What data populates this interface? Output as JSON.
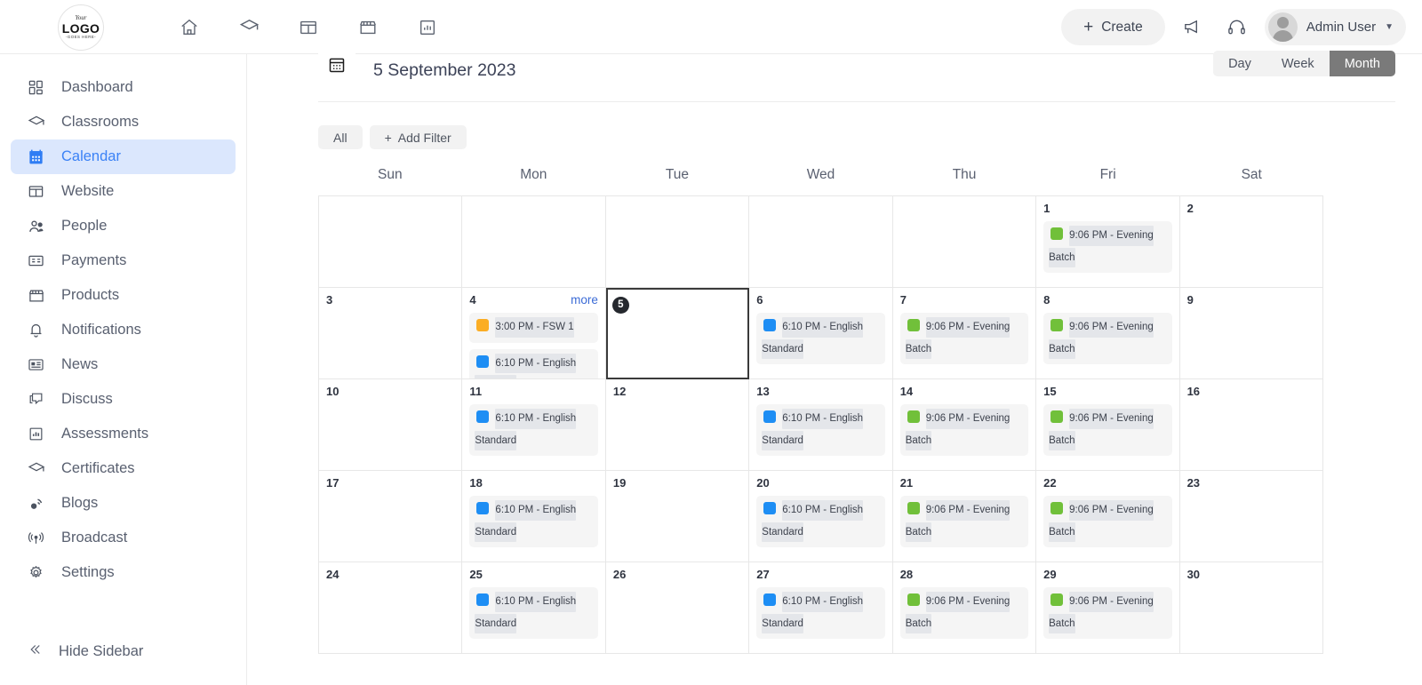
{
  "header": {
    "logo": {
      "line1": "Your",
      "line2": "LOGO",
      "line3": "-GOES HERE-"
    },
    "nav_icons": [
      "home-icon",
      "graduation-cap-icon",
      "website-layout-icon",
      "store-icon",
      "analytics-icon"
    ],
    "create_label": "Create",
    "create_plus": "+",
    "announce_icon": "megaphone-icon",
    "support_icon": "headset-icon",
    "user_name": "Admin User",
    "chevron": "⌄"
  },
  "sidebar": {
    "items": [
      {
        "label": "Dashboard",
        "icon": "dashboard-icon",
        "active": false
      },
      {
        "label": "Classrooms",
        "icon": "graduation-cap-icon",
        "active": false
      },
      {
        "label": "Calendar",
        "icon": "calendar-icon",
        "active": true
      },
      {
        "label": "Website",
        "icon": "website-layout-icon",
        "active": false
      },
      {
        "label": "People",
        "icon": "people-icon",
        "active": false
      },
      {
        "label": "Payments",
        "icon": "payments-card-icon",
        "active": false
      },
      {
        "label": "Products",
        "icon": "store-icon",
        "active": false
      },
      {
        "label": "Notifications",
        "icon": "bell-icon",
        "active": false
      },
      {
        "label": "News",
        "icon": "news-icon",
        "active": false
      },
      {
        "label": "Discuss",
        "icon": "chat-bubble-icon",
        "active": false
      },
      {
        "label": "Assessments",
        "icon": "bar-chart-icon",
        "active": false
      },
      {
        "label": "Certificates",
        "icon": "graduation-cap-icon",
        "active": false
      },
      {
        "label": "Blogs",
        "icon": "blog-rss-icon",
        "active": false
      },
      {
        "label": "Broadcast",
        "icon": "broadcast-antenna-icon",
        "active": false
      },
      {
        "label": "Settings",
        "icon": "gear-icon",
        "active": false
      }
    ],
    "hide_label": "Hide Sidebar",
    "hide_icon": "double-chevron-left-icon",
    "active_bg": "#dbe7fd",
    "active_fg": "#3b82f6"
  },
  "calendar": {
    "date_title": "5 September 2023",
    "date_icon": "calendar-grid-icon",
    "views": [
      {
        "label": "Day",
        "active": false
      },
      {
        "label": "Week",
        "active": false
      },
      {
        "label": "Month",
        "active": true
      }
    ],
    "filters": [
      {
        "label": "All",
        "prefix": ""
      },
      {
        "label": "Add Filter",
        "prefix": "+"
      }
    ],
    "more_label": "more",
    "weekdays": [
      "Sun",
      "Mon",
      "Tue",
      "Wed",
      "Thu",
      "Fri",
      "Sat"
    ],
    "event_colors": {
      "blue": "#1e8ef4",
      "green": "#71c03a",
      "orange": "#fbad24"
    },
    "weeks": [
      [
        {
          "day": "",
          "events": []
        },
        {
          "day": "",
          "events": []
        },
        {
          "day": "",
          "events": []
        },
        {
          "day": "",
          "events": []
        },
        {
          "day": "",
          "events": []
        },
        {
          "day": "1",
          "events": [
            {
              "time": "9:06 PM - Evening",
              "title": "Batch",
              "color": "green"
            }
          ]
        },
        {
          "day": "2",
          "events": []
        }
      ],
      [
        {
          "day": "3",
          "events": []
        },
        {
          "day": "4",
          "more": true,
          "events": [
            {
              "time": "3:00 PM - FSW 1",
              "title": "",
              "color": "orange"
            },
            {
              "time": "6:10 PM - English",
              "title": "Standard",
              "color": "blue"
            }
          ]
        },
        {
          "day": "5",
          "today": true,
          "events": []
        },
        {
          "day": "6",
          "events": [
            {
              "time": "6:10 PM - English",
              "title": "Standard",
              "color": "blue"
            }
          ]
        },
        {
          "day": "7",
          "events": [
            {
              "time": "9:06 PM - Evening",
              "title": "Batch",
              "color": "green"
            }
          ]
        },
        {
          "day": "8",
          "events": [
            {
              "time": "9:06 PM - Evening",
              "title": "Batch",
              "color": "green"
            }
          ]
        },
        {
          "day": "9",
          "events": []
        }
      ],
      [
        {
          "day": "10",
          "events": []
        },
        {
          "day": "11",
          "events": [
            {
              "time": "6:10 PM - English",
              "title": "Standard",
              "color": "blue"
            }
          ]
        },
        {
          "day": "12",
          "events": []
        },
        {
          "day": "13",
          "events": [
            {
              "time": "6:10 PM - English",
              "title": "Standard",
              "color": "blue"
            }
          ]
        },
        {
          "day": "14",
          "events": [
            {
              "time": "9:06 PM - Evening",
              "title": "Batch",
              "color": "green"
            }
          ]
        },
        {
          "day": "15",
          "events": [
            {
              "time": "9:06 PM - Evening",
              "title": "Batch",
              "color": "green"
            }
          ]
        },
        {
          "day": "16",
          "events": []
        }
      ],
      [
        {
          "day": "17",
          "events": []
        },
        {
          "day": "18",
          "events": [
            {
              "time": "6:10 PM - English",
              "title": "Standard",
              "color": "blue"
            }
          ]
        },
        {
          "day": "19",
          "events": []
        },
        {
          "day": "20",
          "events": [
            {
              "time": "6:10 PM - English",
              "title": "Standard",
              "color": "blue"
            }
          ]
        },
        {
          "day": "21",
          "events": [
            {
              "time": "9:06 PM - Evening",
              "title": "Batch",
              "color": "green"
            }
          ]
        },
        {
          "day": "22",
          "events": [
            {
              "time": "9:06 PM - Evening",
              "title": "Batch",
              "color": "green"
            }
          ]
        },
        {
          "day": "23",
          "events": []
        }
      ],
      [
        {
          "day": "24",
          "events": []
        },
        {
          "day": "25",
          "events": [
            {
              "time": "6:10 PM - English",
              "title": "Standard",
              "color": "blue"
            }
          ]
        },
        {
          "day": "26",
          "events": []
        },
        {
          "day": "27",
          "events": [
            {
              "time": "6:10 PM - English",
              "title": "Standard",
              "color": "blue"
            }
          ]
        },
        {
          "day": "28",
          "events": [
            {
              "time": "9:06 PM - Evening",
              "title": "Batch",
              "color": "green"
            }
          ]
        },
        {
          "day": "29",
          "events": [
            {
              "time": "9:06 PM - Evening",
              "title": "Batch",
              "color": "green"
            }
          ]
        },
        {
          "day": "30",
          "events": []
        }
      ]
    ]
  }
}
